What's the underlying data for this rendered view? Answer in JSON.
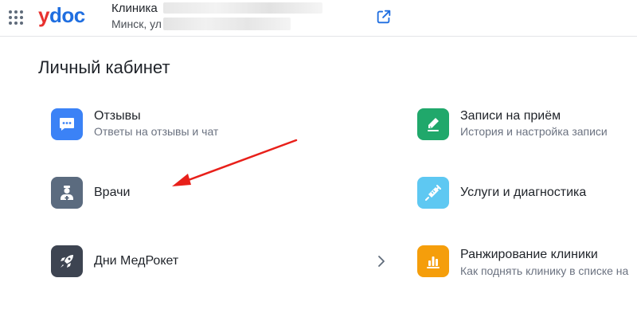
{
  "header": {
    "logo_y": "y",
    "logo_rest": "doc",
    "clinic_name": "Клиника",
    "clinic_address": "Минск, ул"
  },
  "page_title": "Личный кабинет",
  "items": [
    {
      "label": "Отзывы",
      "subtitle": "Ответы на отзывы и чат",
      "icon": "chat-icon",
      "color": "#3b82f6"
    },
    {
      "label": "Врачи",
      "subtitle": "",
      "icon": "doctor-icon",
      "color": "#5b6b7f"
    },
    {
      "label": "Дни МедРокет",
      "subtitle": "",
      "icon": "rocket-icon",
      "color": "#3d4451"
    },
    {
      "label": "Записи на приём",
      "subtitle": "История и настройка записи",
      "icon": "edit-icon",
      "color": "#20a86b"
    },
    {
      "label": "Услуги и диагностика",
      "subtitle": "",
      "icon": "syringe-icon",
      "color": "#5ec8f2"
    },
    {
      "label": "Ранжирование клиники",
      "subtitle": "Как поднять клинику в списке на",
      "icon": "ranking-chart-icon",
      "color": "#f59e0b"
    }
  ],
  "colors": {
    "accent": "#1f6ee0",
    "logo_red": "#e8312f",
    "annotation_arrow": "#e8201a"
  }
}
